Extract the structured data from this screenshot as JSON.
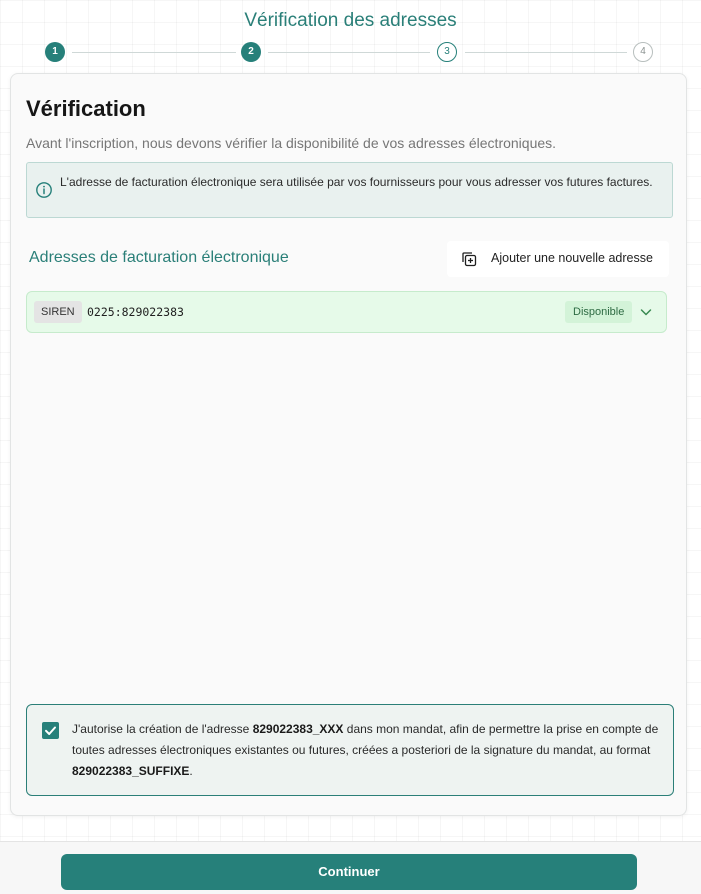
{
  "header": {
    "title": "Vérification des adresses"
  },
  "stepper": {
    "steps": [
      "1",
      "2",
      "3",
      "4"
    ]
  },
  "card": {
    "title": "Vérification",
    "description": "Avant l'inscription, nous devons vérifier la disponibilité de vos adresses électroniques.",
    "info": {
      "icon": "info-icon",
      "text": "L'adresse de facturation électronique sera utilisée par vos fournisseurs pour vous adresser vos futures factures."
    },
    "section": {
      "title": "Adresses de facturation électronique",
      "add_button": {
        "label": "Ajouter une nouvelle adresse",
        "icon": "add-copy-icon"
      }
    },
    "addresses": [
      {
        "type": "SIREN",
        "value": "0225:829022383",
        "status": "Disponible"
      }
    ],
    "consent": {
      "checked": true,
      "text_1": "J'autorise la création de l'adresse ",
      "bold_1": "829022383_XXX",
      "text_2": " dans mon mandat, afin de permettre la prise en compte de toutes adresses électroniques existantes ou futures, créées a posteriori de la signature du mandat, au format ",
      "bold_2": "829022383_SUFFIXE",
      "text_3": "."
    }
  },
  "footer": {
    "continue_label": "Continuer"
  },
  "colors": {
    "accent": "#26807a",
    "available_bg": "#e6fae9",
    "info_bg": "#e9f1ef"
  }
}
